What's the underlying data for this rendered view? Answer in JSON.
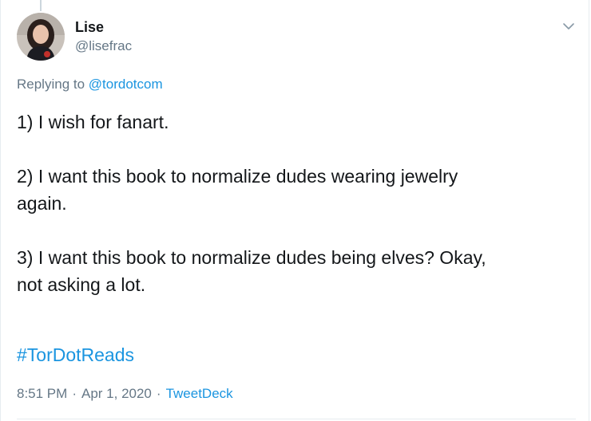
{
  "author": {
    "display_name": "Lise",
    "handle": "@lisefrac"
  },
  "reply": {
    "prefix": "Replying to ",
    "target": "@tordotcom"
  },
  "tweet": {
    "line1": "1) I wish for fanart.",
    "line2a": "2) I want this book to normalize dudes wearing jewelry",
    "line2b": "again.",
    "line3a": "3) I want this book to normalize dudes being elves? Okay,",
    "line3b": "not asking a lot.",
    "hashtag": "#TorDotReads"
  },
  "meta": {
    "time": "8:51 PM",
    "separator": "·",
    "date": "Apr 1, 2020",
    "source": "TweetDeck"
  },
  "icons": {
    "caret": "chevron-down-icon",
    "avatar": "user-avatar"
  },
  "colors": {
    "link": "#1b95e0",
    "secondary_text": "#657786",
    "primary_text": "#14171a"
  }
}
